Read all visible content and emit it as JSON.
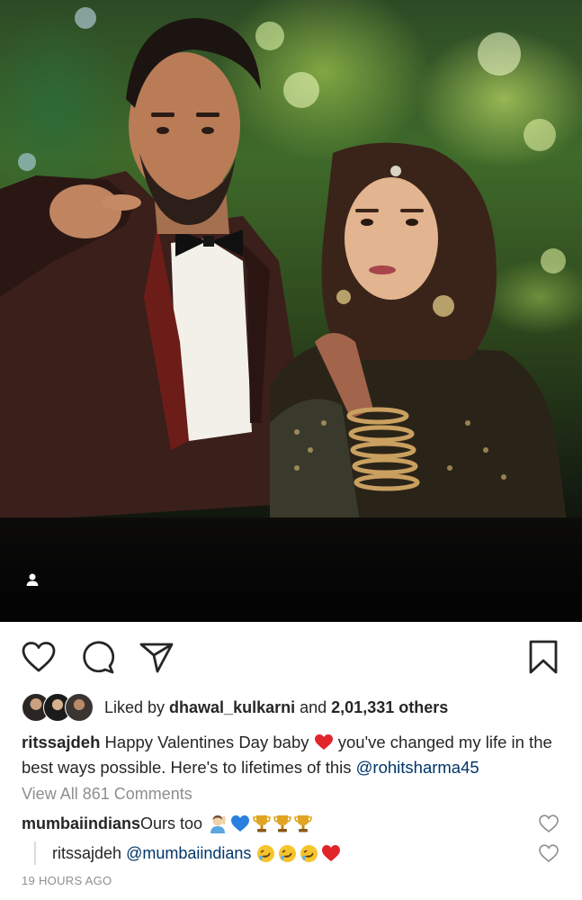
{
  "post": {
    "image_alt": "Couple photo",
    "tag_icon": "person-icon"
  },
  "actions": {
    "like_icon": "heart-icon",
    "comment_icon": "comment-icon",
    "share_icon": "send-icon",
    "save_icon": "bookmark-icon"
  },
  "likes": {
    "prefix": "Liked by ",
    "user": "dhawal_kulkarni",
    "middle": " and ",
    "count": "2,01,331 others"
  },
  "caption": {
    "username": "ritssajdeh",
    "text_before": " Happy Valentines Day baby ",
    "text_after": " you've changed my life in the best ways possible. Here's to lifetimes of this ",
    "mention": "@rohitsharma45"
  },
  "comments": {
    "view_all": "View All 861 Comments",
    "items": [
      {
        "username": "mumbaiindians",
        "text": " Ours too"
      },
      {
        "username": "ritssajdeh",
        "mention": "@mumbaiindians"
      }
    ]
  },
  "timestamp": "19 HOURS AGO",
  "colors": {
    "text": "#262626",
    "secondary": "#8e8e8e",
    "mention": "#003569",
    "heart_red": "#e0262b",
    "blue_heart": "#2a7fe0",
    "trophy_gold": "#e0a523"
  }
}
